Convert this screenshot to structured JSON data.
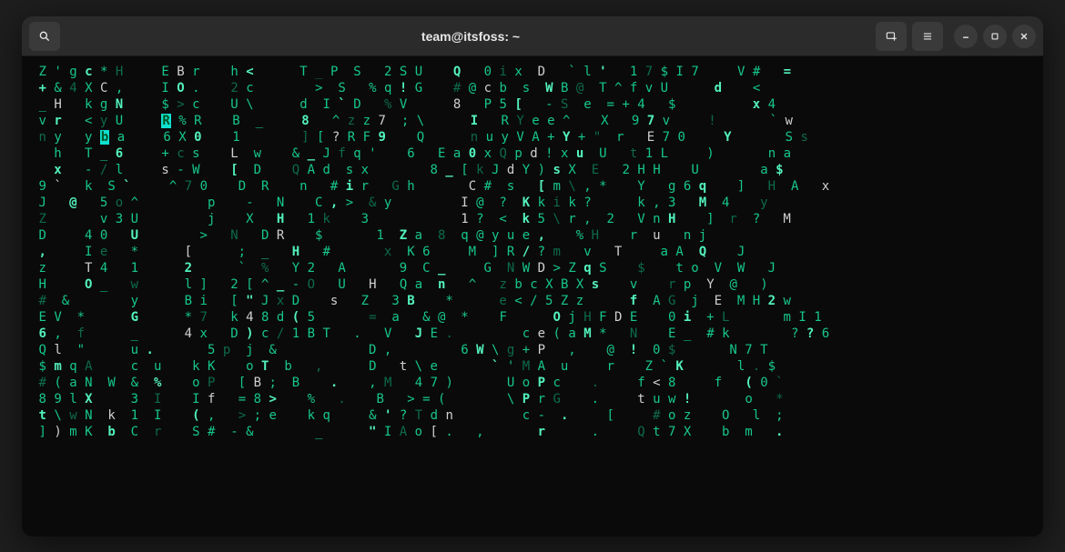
{
  "window": {
    "title": "team@itsfoss: ~"
  },
  "icons": {
    "search": "search-icon",
    "newtab": "new-tab-icon",
    "menu": "hamburger-menu-icon",
    "min": "minimize-icon",
    "max": "maximize-icon",
    "close": "close-icon"
  },
  "matrix": {
    "rows": [
      " Z ' g c * H     E B r    h <      T _ P  S   2 S U    Q   0 i x  D   ` l '   1 7 $ I 7     V #   =  ",
      " + & 4 X C ,     I O .    2 c        >  S   % q ! G    # @ c b  s  W B @  T ^ f v U      d    <  ",
      " _ H   k g N     $ > c    U \\      d  I ` D   % V      8   P 5 [   - S  e  = + 4   $          x 4",
      " v r   < y U     R % R    B  _     8   ^ z z 7  ; \\      I   R Y e e ^    X   9 7 v     !       ` w",
      " n y   y b a     6 X 0    1        ] [ ? R F 9    Q      n u y V A + Y + \"  r   E 7 0     Y       S s",
      "   h   T _ 6     + c s    L  w    & _ J f q '    6   E a 0 x Q p d ! x u  U   t 1 L     )       n a",
      "   x   - / l     s - W    [  D    Q A d  s x        8 _ [ k J d Y ) s X  E   2 H H    U        a $",
      " 9 `   k  S `     ^ 7 0    D  R    n   # i r   G h       C #  s   [ m \\ , *    Y   g 6 q    ]   H  A   x ",
      " J   @   5 o ^         p    -   N    C , >  & y         I @  ?  K k i k ?      k , 3   M  4    y",
      " Z       v 3 U         j    X   H   1 k    3            1 ?  <  k 5 \\ r ,  2   V n H    ]  r  ?   M",
      " D     4 0   U        >   N   D R    $       1  Z a  8  q @ y u e ,    % H    r  u   n j",
      " ,     I e   *      [      ;  _   H   #       x  K 6     M  ] R / ? m   v   T     a A  Q    J",
      " z     T 4   1      2      `  %   Y 2   A       9  C _     G  N W D > Z q S    $    t o  V  W   J",
      " H     O _   w      l ]   2 [ ^ _ - O   U   H   Q a  n   ^   z b c X B X s    v    r p  Y  @   )",
      " #  &        y      B i   [ \" J x D    s   Z   3 B    *      e < / 5 Z z      f  A G  j  E  M H 2 w",
      " E V  *      G      * 7   k 4 8 d ( 5       =  a   & @  *    F      O j H F D E    0 i  + L       m I 1",
      " 6 ,  f      _      4 x   D ) c / 1 B T   .   V   J E .         c e ( a M *   N    E _  # k        ? ? 6",
      " Q l  \"      u .       5 p  j  &            D ,         6 W \\ g + P   ,    @  !  0 $       N 7 T",
      " $ m q A     c  u    k K    o T  b   ,      D   t \\ e       ` ' M A  u     r    Z ` K       l . $",
      " # ( a N  W  &  %    o P   [ B ;  B    .    , M   4 7 )       U o P c    .     f < 8     f   ( 0 `",
      " 8 9 l X     3  I    I f   = 8 >    %   .    B   > = (        \\ P r G    .     t u w !       o   *",
      " t \\ w N  k  1  I    ( ,   > ; e    k q     & ' ? T d n         c -  .     [     # o z    O   l  ;",
      " ] ) m K  b  C  r    S #  - &        _      \" I A o [ .   ,       r      .     Q t 7 X    b  m   . "
    ]
  }
}
